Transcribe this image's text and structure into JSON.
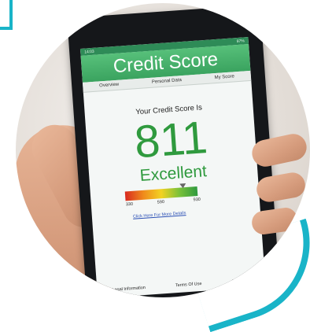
{
  "status_bar": {
    "time": "14:03",
    "battery": "97%"
  },
  "app": {
    "title": "Credit Score"
  },
  "tabs": [
    "Overview",
    "Personal Data",
    "My Score"
  ],
  "main": {
    "headline": "Your Credit Score Is",
    "score": "811",
    "rating": "Excellent",
    "gauge": {
      "min": "330",
      "mid": "590",
      "max": "930",
      "value_fraction": 0.8
    },
    "link": "Click Here For More Details"
  },
  "footer": [
    "Legal Information",
    "Terms Of Use",
    "Copyright"
  ],
  "colors": {
    "accent": "#2f9a3e",
    "header": "#3aa35f",
    "brand_teal": "#19b4c8"
  }
}
